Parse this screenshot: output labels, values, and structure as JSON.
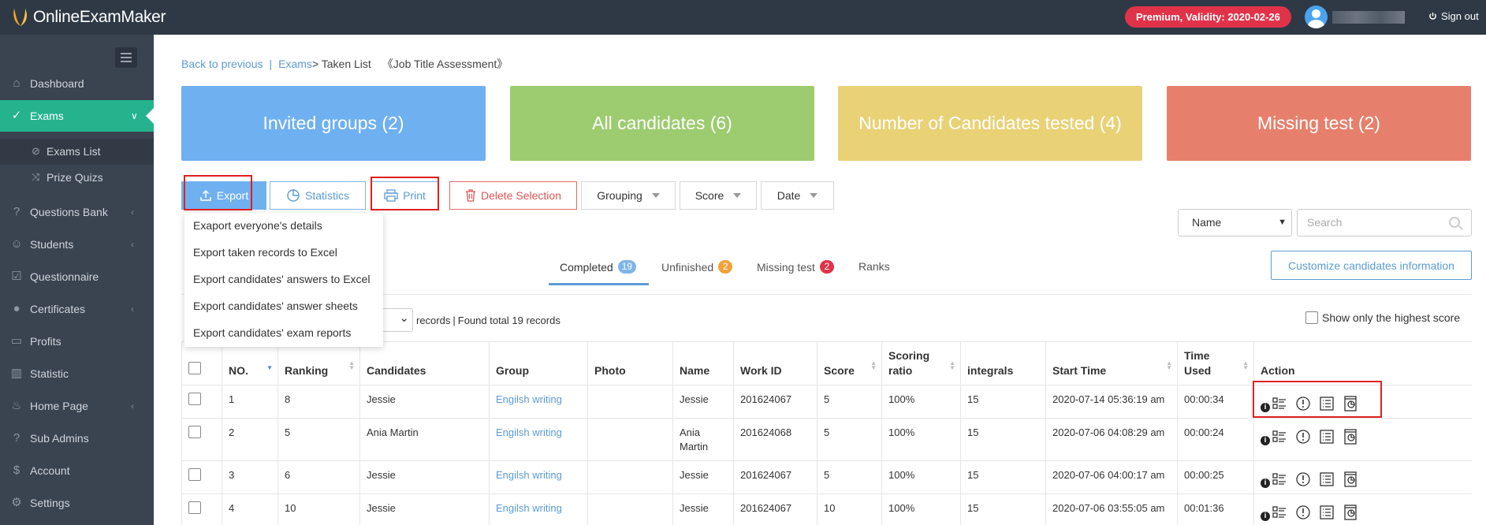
{
  "app": {
    "logo_prefix": "Online",
    "logo_suffix": "ExamMaker",
    "premium": "Premium, Validity: 2020-02-26",
    "signout": "Sign out"
  },
  "sidebar": {
    "items": [
      {
        "label": "Dashboard",
        "icon": "home-icon"
      },
      {
        "label": "Exams",
        "icon": "check-circle-icon",
        "active": true
      },
      {
        "label": "Questions Bank",
        "icon": "question-circle-icon"
      },
      {
        "label": "Students",
        "icon": "users-icon"
      },
      {
        "label": "Questionnaire",
        "icon": "checkbox-icon"
      },
      {
        "label": "Certificates",
        "icon": "certificate-icon"
      },
      {
        "label": "Profits",
        "icon": "card-icon"
      },
      {
        "label": "Statistic",
        "icon": "bar-chart-icon"
      },
      {
        "label": "Home Page",
        "icon": "home-page-icon"
      },
      {
        "label": "Sub Admins",
        "icon": "question-circle-icon"
      },
      {
        "label": "Account",
        "icon": "dollar-icon"
      },
      {
        "label": "Settings",
        "icon": "gear-icon"
      }
    ],
    "sub_items": [
      {
        "label": "Exams List",
        "icon": "check-circle-icon"
      },
      {
        "label": "Prize Quizs",
        "icon": "shuffle-icon"
      }
    ]
  },
  "breadcrumb": {
    "back": "Back to previous",
    "sep": "|",
    "exams": "Exams",
    "current": "> Taken List",
    "exam_name": "《Job Title Assessment》"
  },
  "cards": [
    {
      "label": "Invited groups (2)",
      "color": "#6fb0f0"
    },
    {
      "label": "All candidates (6)",
      "color": "#9ccc6f"
    },
    {
      "label": "Number of Candidates tested (4)",
      "color": "#e9d176"
    },
    {
      "label": "Missing test (2)",
      "color": "#e6806c"
    }
  ],
  "toolbar": {
    "export": "Export",
    "statistics": "Statistics",
    "print": "Print",
    "delete": "Delete Selection",
    "grouping": "Grouping",
    "score": "Score",
    "date": "Date"
  },
  "export_menu": [
    "Exaport everyone's details",
    "Export taken records to Excel",
    "Export candidates' answers to Excel",
    "Export candidates' answer sheets",
    "Export candidates' exam reports"
  ],
  "filters": {
    "field": "Name",
    "search_placeholder": "Search"
  },
  "tabs": [
    {
      "label": "Completed",
      "count": "19",
      "color": "#7fb4ea"
    },
    {
      "label": "Unfinished",
      "count": "2",
      "color": "#f0a23a"
    },
    {
      "label": "Missing test",
      "count": "2",
      "color": "#e0334a"
    },
    {
      "label": "Ranks",
      "count": ""
    }
  ],
  "customize": "Customize candidates information",
  "records": {
    "label": "records",
    "found": "Found total 19 records"
  },
  "highest_score": "Show only the highest score",
  "table": {
    "headers": [
      "NO.",
      "Ranking",
      "Candidates",
      "Group",
      "Photo",
      "Name",
      "Work ID",
      "Score",
      "Scoring ratio",
      "integrals",
      "Start Time",
      "Time Used",
      "Action"
    ],
    "rows": [
      {
        "no": "1",
        "ranking": "8",
        "candidate": "Jessie",
        "group": "Engilsh writing",
        "photo": "",
        "name": "Jessie",
        "work_id": "201624067",
        "score": "5",
        "ratio": "100%",
        "integrals": "15",
        "start": "2020-07-14 05:36:19 am",
        "used": "00:00:34"
      },
      {
        "no": "2",
        "ranking": "5",
        "candidate": "Ania Martin",
        "group": "Engilsh writing",
        "photo": "",
        "name": "Ania Martin",
        "work_id": "201624068",
        "score": "5",
        "ratio": "100%",
        "integrals": "15",
        "start": "2020-07-06 04:08:29 am",
        "used": "00:00:24"
      },
      {
        "no": "3",
        "ranking": "6",
        "candidate": "Jessie",
        "group": "Engilsh writing",
        "photo": "",
        "name": "Jessie",
        "work_id": "201624067",
        "score": "5",
        "ratio": "100%",
        "integrals": "15",
        "start": "2020-07-06 04:00:17 am",
        "used": "00:00:25"
      },
      {
        "no": "4",
        "ranking": "10",
        "candidate": "Jessie",
        "group": "Engilsh writing",
        "photo": "",
        "name": "Jessie",
        "work_id": "201624067",
        "score": "10",
        "ratio": "100%",
        "integrals": "15",
        "start": "2020-07-06 03:55:05 am",
        "used": "00:01:36"
      }
    ]
  }
}
